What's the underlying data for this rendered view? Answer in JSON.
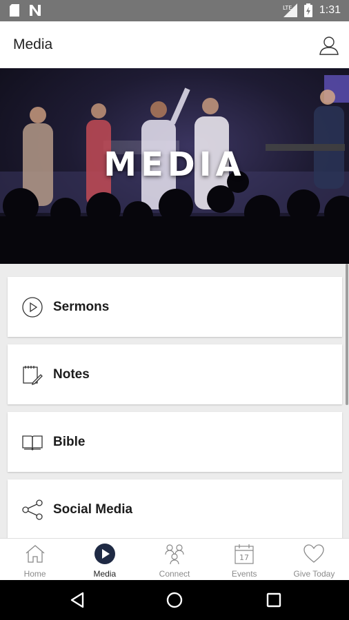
{
  "status_bar": {
    "time": "1:31",
    "network": "LTE"
  },
  "app_bar": {
    "title": "Media"
  },
  "hero": {
    "title": "MEDIA"
  },
  "menu": {
    "items": [
      {
        "label": "Sermons",
        "icon": "play-circle-icon"
      },
      {
        "label": "Notes",
        "icon": "notepad-pencil-icon"
      },
      {
        "label": "Bible",
        "icon": "open-book-icon"
      },
      {
        "label": "Social Media",
        "icon": "share-icon"
      }
    ]
  },
  "bottom_nav": {
    "active": "Media",
    "items": [
      {
        "label": "Home",
        "icon": "home-icon"
      },
      {
        "label": "Media",
        "icon": "media-play-icon"
      },
      {
        "label": "Connect",
        "icon": "people-icon"
      },
      {
        "label": "Events",
        "icon": "calendar-icon",
        "badge": "17"
      },
      {
        "label": "Give Today",
        "icon": "heart-icon"
      }
    ]
  },
  "colors": {
    "active_nav": "#1f2a44",
    "status_bar": "#757575",
    "background": "#ececec"
  }
}
